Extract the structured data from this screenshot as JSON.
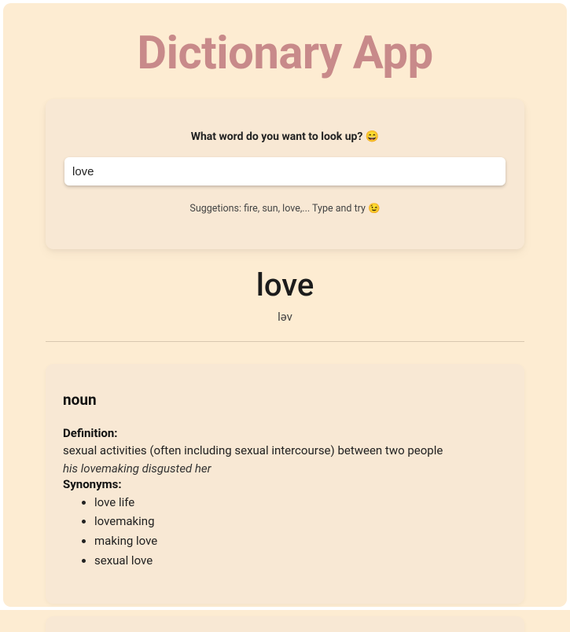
{
  "app": {
    "title": "Dictionary App"
  },
  "search": {
    "prompt": "What word do you want to look up? 😄",
    "value": "love",
    "placeholder": "",
    "suggestion": "Suggetions: fire, sun, love,... Type and try 😉"
  },
  "result": {
    "word": "love",
    "phonetic": "ləv",
    "entries": [
      {
        "partOfSpeech": "noun",
        "definitionLabel": "Definition:",
        "definition": "sexual activities (often including sexual intercourse) between two people",
        "example": "his lovemaking disgusted her",
        "synonymsLabel": "Synonyms:",
        "synonyms": [
          "love life",
          "lovemaking",
          "making love",
          "sexual love"
        ]
      }
    ]
  }
}
